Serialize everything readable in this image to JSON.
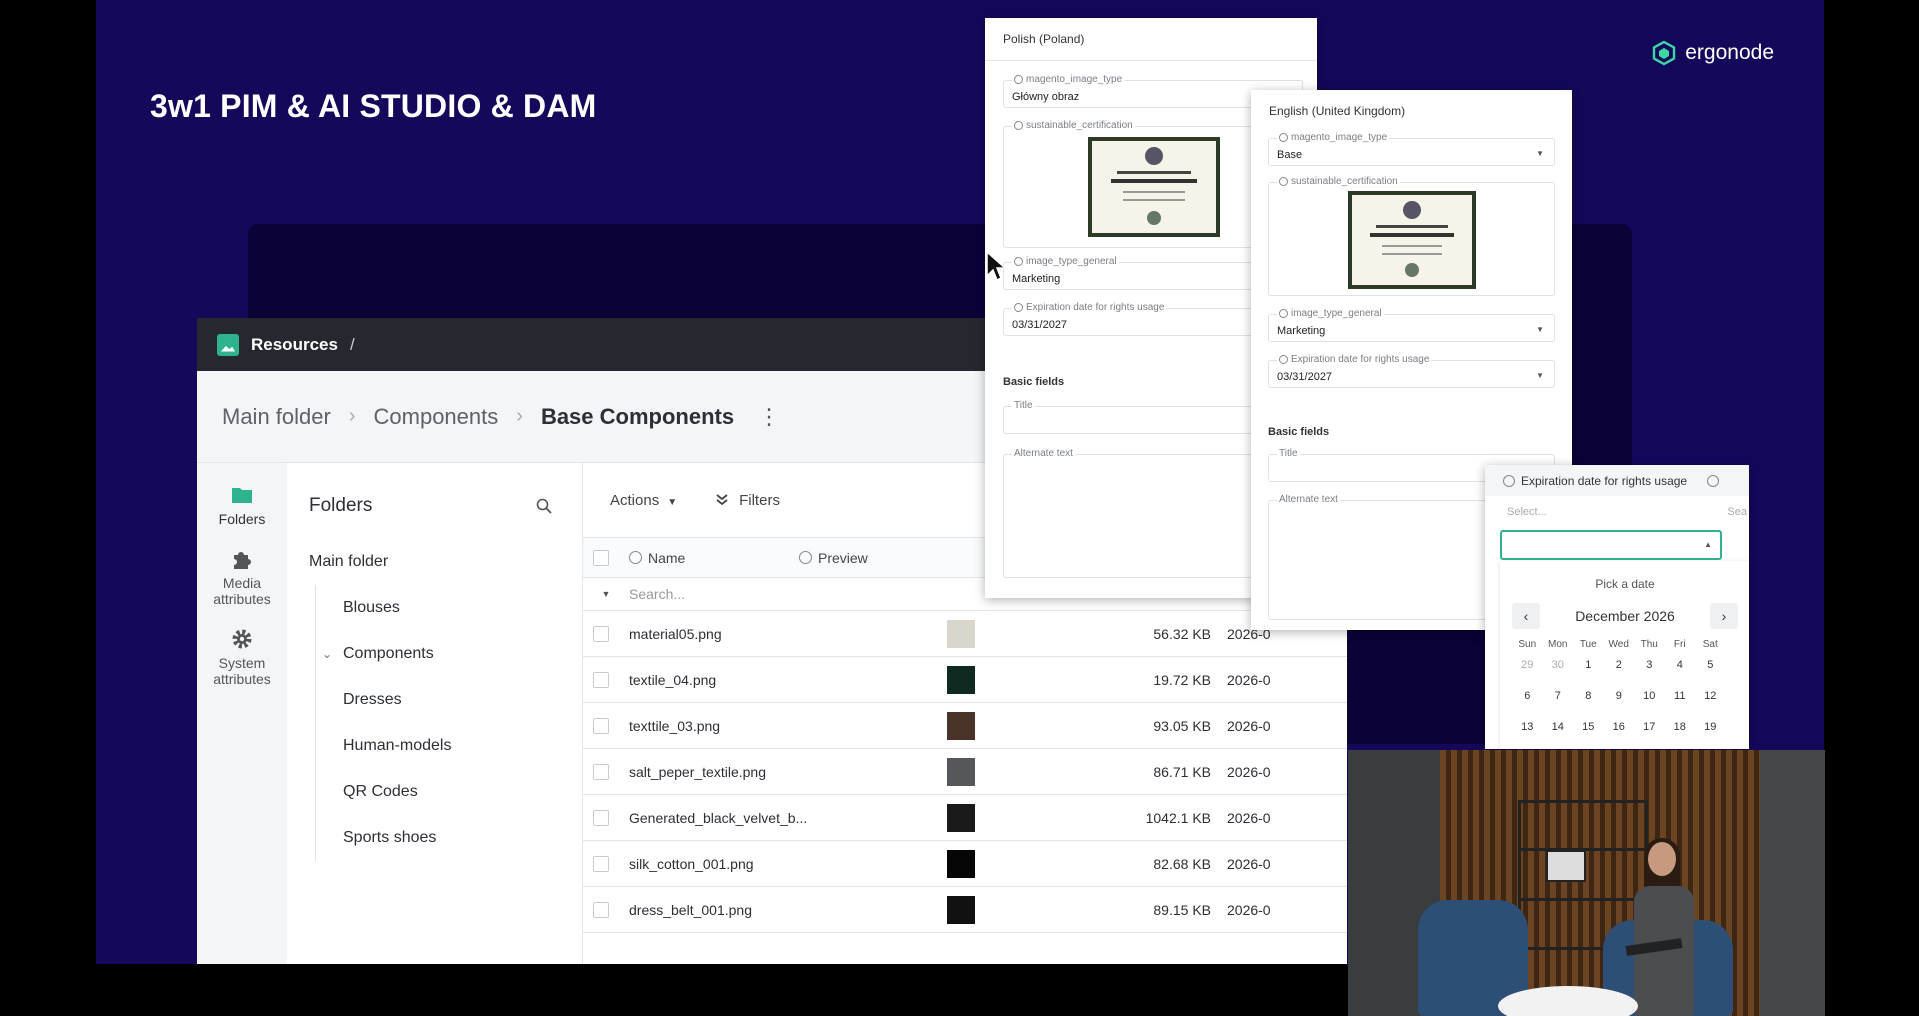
{
  "slide": {
    "title": "3w1 PIM & AI STUDIO & DAM",
    "brand": "ergonode"
  },
  "app": {
    "topbar": {
      "title": "Resources",
      "slash": "/"
    },
    "breadcrumb": [
      "Main folder",
      "Components",
      "Base Components"
    ],
    "rail": [
      {
        "label": "Folders",
        "icon": "folder-icon"
      },
      {
        "label": "Media attributes",
        "icon": "puzzle-icon"
      },
      {
        "label": "System attributes",
        "icon": "gear-icon"
      }
    ],
    "folders": {
      "title": "Folders",
      "root": "Main folder",
      "items": [
        "Blouses",
        "Components",
        "Dresses",
        "Human-models",
        "QR Codes",
        "Sports shoes"
      ]
    },
    "toolbar": {
      "actions": "Actions",
      "filters": "Filters"
    },
    "grid": {
      "columns": {
        "name": "Name",
        "preview": "Preview"
      },
      "search_placeholder": "Search...",
      "rows": [
        {
          "name": "material05.png",
          "size": "56.32 KB",
          "date": "2026-0",
          "color": "#d9d6cc"
        },
        {
          "name": "textile_04.png",
          "size": "19.72 KB",
          "date": "2026-0",
          "color": "#0f2a20"
        },
        {
          "name": "texttile_03.png",
          "size": "93.05 KB",
          "date": "2026-0",
          "color": "#4a3429"
        },
        {
          "name": "salt_peper_textile.png",
          "size": "86.71 KB",
          "date": "2026-0",
          "color": "#55575a"
        },
        {
          "name": "Generated_black_velvet_b...",
          "size": "1042.1 KB",
          "date": "2026-0",
          "color": "#1a1a1a"
        },
        {
          "name": "silk_cotton_001.png",
          "size": "82.68 KB",
          "date": "2026-0",
          "color": "#050505"
        },
        {
          "name": "dress_belt_001.png",
          "size": "89.15 KB",
          "date": "2026-0",
          "color": "#111111"
        }
      ]
    }
  },
  "panel_pl": {
    "title": "Polish (Poland)",
    "f1_label": "magento_image_type",
    "f1_value": "Główny obraz",
    "f2_label": "sustainable_certification",
    "f3_label": "image_type_general",
    "f3_value": "Marketing",
    "f4_label": "Expiration date for rights usage",
    "f4_value": "03/31/2027",
    "section": "Basic fields",
    "f5_label": "Title",
    "f6_label": "Alternate text"
  },
  "panel_en": {
    "title": "English (United Kingdom)",
    "f1_label": "magento_image_type",
    "f1_value": "Base",
    "f2_label": "sustainable_certification",
    "f3_label": "image_type_general",
    "f3_value": "Marketing",
    "f4_label": "Expiration date for rights usage",
    "f4_value": "03/31/2027",
    "section": "Basic fields",
    "f5_label": "Title",
    "f6_label": "Alternate text"
  },
  "datepicker": {
    "header": "Expiration date for rights usage",
    "select_placeholder": "Select...",
    "search_hint": "Sea",
    "pick": "Pick a date",
    "month": "December 2026",
    "dow": [
      "Sun",
      "Mon",
      "Tue",
      "Wed",
      "Thu",
      "Fri",
      "Sat"
    ],
    "weeks": [
      [
        "29",
        "30",
        "1",
        "2",
        "3",
        "4",
        "5"
      ],
      [
        "6",
        "7",
        "8",
        "9",
        "10",
        "11",
        "12"
      ],
      [
        "13",
        "14",
        "15",
        "16",
        "17",
        "18",
        "19"
      ]
    ]
  }
}
